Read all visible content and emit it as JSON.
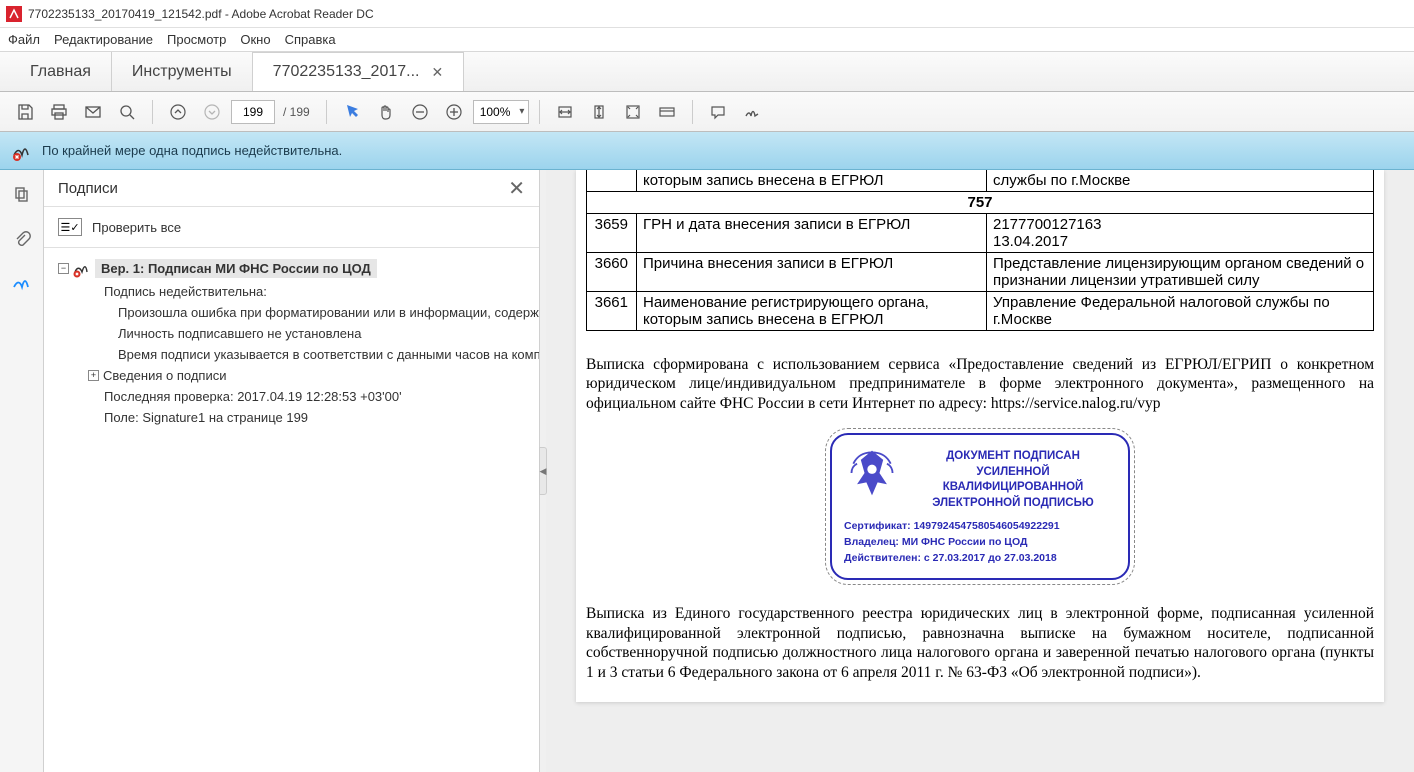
{
  "window": {
    "title": "7702235133_20170419_121542.pdf - Adobe Acrobat Reader DC"
  },
  "menu": {
    "file": "Файл",
    "edit": "Редактирование",
    "view": "Просмотр",
    "window": "Окно",
    "help": "Справка"
  },
  "tabs": {
    "home": "Главная",
    "tools": "Инструменты",
    "file": "7702235133_2017..."
  },
  "toolbar": {
    "page_current": "199",
    "page_total": "/ 199",
    "zoom": "100%"
  },
  "sigbar": {
    "text": "По крайней мере одна подпись недействительна."
  },
  "panel": {
    "title": "Подписи",
    "check_all": "Проверить все",
    "version_label": "Вер. 1: Подписан МИ ФНС России по ЦОД",
    "invalid_header": "Подпись недействительна:",
    "err1": "Произошла ошибка при форматировании или в информации, содержаще",
    "err2": "Личность подписавшего не установлена",
    "err3": "Время подписи указывается в соответствии с данными часов на компьютер",
    "details": "Сведения о подписи",
    "last_check": "Последняя проверка: 2017.04.19 12:28:53 +03'00'",
    "field": "Поле: Signature1 на странице 199"
  },
  "doc": {
    "row0_name": "которым запись внесена в ЕГРЮЛ",
    "row0_val": "службы по г.Москве",
    "section_num": "757",
    "rows": [
      {
        "n": "3659",
        "name": "ГРН и дата внесения записи в ЕГРЮЛ",
        "val": "2177700127163\n13.04.2017"
      },
      {
        "n": "3660",
        "name": "Причина внесения записи в ЕГРЮЛ",
        "val": "Представление лицензирующим органом сведений о признании лицензии утратившей силу"
      },
      {
        "n": "3661",
        "name": "Наименование регистрирующего органа, которым запись внесена в ЕГРЮЛ",
        "val": "Управление Федеральной налоговой службы по г.Москве"
      }
    ],
    "para1": "Выписка сформирована с использованием сервиса «Предоставление сведений из ЕГРЮЛ/ЕГРИП о конкретном юридическом лице/индивидуальном предпринимателе в форме электронного документа», размещенного на официальном сайте ФНС России в сети Интернет по адресу: https://service.nalog.ru/vyp",
    "stamp": {
      "title": "ДОКУМЕНТ ПОДПИСАН\nУСИЛЕННОЙ КВАЛИФИЦИРОВАННОЙ\nЭЛЕКТРОННОЙ ПОДПИСЬЮ",
      "cert_label": "Сертификат:",
      "cert_val": "1497924547580546054922291",
      "owner_label": "Владелец:",
      "owner_val": "МИ ФНС России по ЦОД",
      "valid_label": "Действителен:",
      "valid_val": "с 27.03.2017 до 27.03.2018"
    },
    "para2": "Выписка из Единого государственного реестра юридических лиц в электронной форме, подписанная усиленной квалифицированной электронной подписью, равнозначна выписке на бумажном носителе, подписанной собственноручной подписью должностного лица налогового органа и заверенной печатью налогового органа (пункты 1 и 3 статьи 6 Федерального закона от 6 апреля 2011 г. № 63-ФЗ «Об электронной подписи»)."
  }
}
